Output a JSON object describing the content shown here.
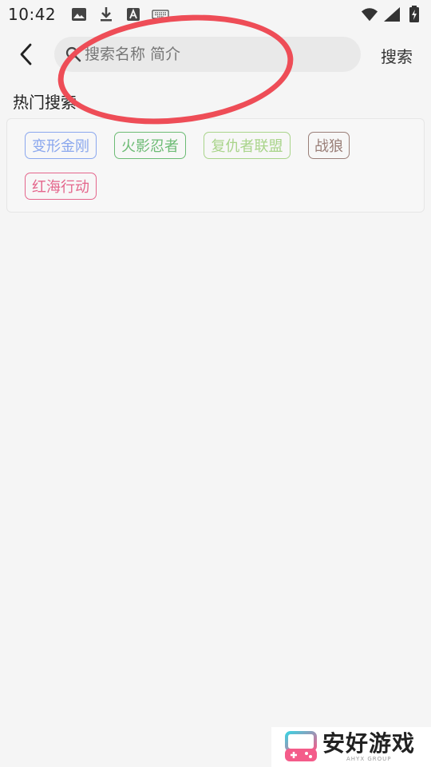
{
  "status_bar": {
    "time": "10:42",
    "left_icons": [
      "image-icon",
      "download-icon",
      "a-icon",
      "keyboard-icon"
    ],
    "right_icons": [
      "wifi-icon",
      "signal-icon",
      "battery-icon"
    ]
  },
  "header": {
    "search_placeholder": "搜索名称 简介",
    "search_value": "",
    "search_button_label": "搜索"
  },
  "hot_searches": {
    "title": "热门搜索",
    "tags": [
      {
        "label": "变形金刚",
        "color": "#8aa7ee"
      },
      {
        "label": "火影忍者",
        "color": "#6cbb74"
      },
      {
        "label": "复仇者联盟",
        "color": "#a9d48a"
      },
      {
        "label": "战狼",
        "color": "#9a7f78"
      },
      {
        "label": "红海行动",
        "color": "#e4668c"
      }
    ]
  },
  "watermark": {
    "text": "安好游戏",
    "subtext": "AHYX GROUP"
  },
  "colors": {
    "background": "#f5f5f5",
    "search_box": "#e9e9e9",
    "annotation": "#ee4d57"
  }
}
